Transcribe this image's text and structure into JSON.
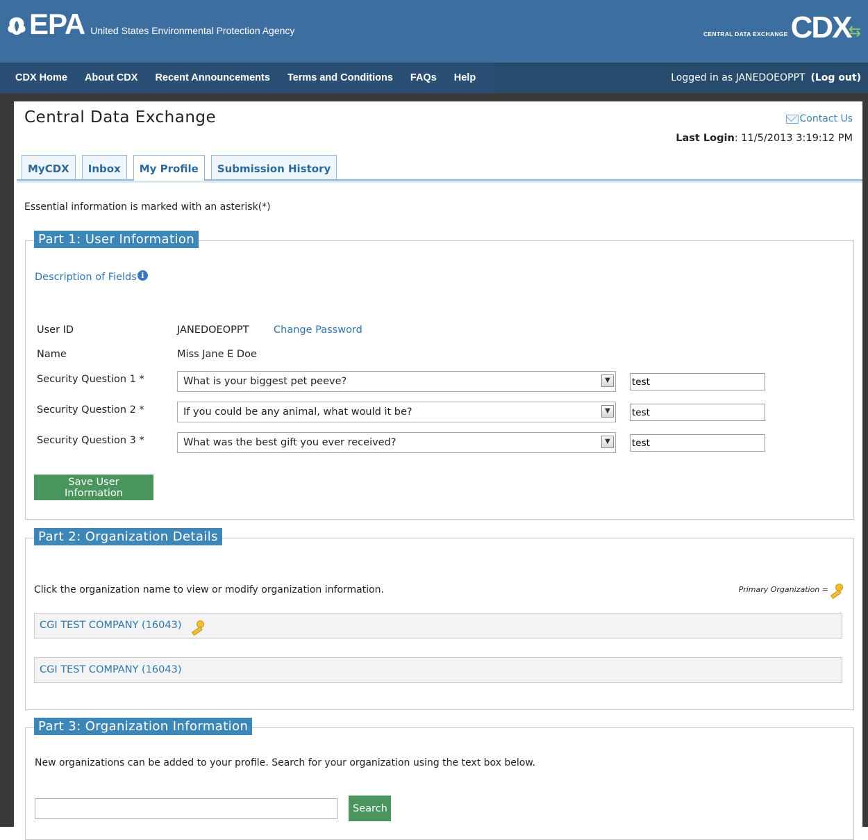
{
  "header": {
    "agency_mark": "EPA",
    "agency_name": "United States Environmental Protection Agency",
    "cdx_small": "CENTRAL DATA EXCHANGE",
    "cdx_big": "CDX"
  },
  "nav": {
    "items": [
      "CDX Home",
      "About CDX",
      "Recent Announcements",
      "Terms and Conditions",
      "FAQs",
      "Help"
    ],
    "logged_in_text": "Logged in as JANEDOEOPPT",
    "logout_label": "(Log out)"
  },
  "page": {
    "title": "Central Data Exchange",
    "contact_label": "Contact Us",
    "last_login_label": "Last Login",
    "last_login_value": ": 11/5/2013 3:19:12 PM",
    "essential_note": "Essential information is marked with an asterisk(*)"
  },
  "tabs": [
    "MyCDX",
    "Inbox",
    "My Profile",
    "Submission History"
  ],
  "part1": {
    "legend": "Part 1: User Information",
    "description_link": "Description of Fields",
    "user_id_label": "User ID",
    "user_id_value": "JANEDOEOPPT",
    "change_password": "Change Password",
    "name_label": "Name",
    "name_value": "Miss Jane E Doe",
    "questions": [
      {
        "label": "Security Question 1 *",
        "question": "What is your biggest pet peeve?",
        "answer": "test"
      },
      {
        "label": "Security Question 2 *",
        "question": "If you could be any animal, what would it be?",
        "answer": "test"
      },
      {
        "label": "Security Question 3 *",
        "question": "What was the best gift you ever received?",
        "answer": "test"
      }
    ],
    "save_button": "Save User Information"
  },
  "part2": {
    "legend": "Part 2: Organization Details",
    "hint": "Click the organization name to view or modify organization information.",
    "primary_legend": "Primary Organization =",
    "organizations": [
      "CGI TEST COMPANY (16043)",
      "CGI TEST COMPANY (16043)"
    ]
  },
  "part3": {
    "legend": "Part 3: Organization Information",
    "hint": "New organizations can be added to your profile. Search for your organization using the text box below.",
    "search_value": "",
    "search_button": "Search"
  },
  "icons": {
    "mail": "mail-icon",
    "info": "info-icon",
    "key": "key-icon",
    "select_arrow": "chevron-down-icon"
  },
  "colors": {
    "header_blue": "#3d6ea0",
    "nav_dark": "#2b4f74",
    "legend_blue": "#3d86b8",
    "button_green": "#4a945e",
    "link_blue": "#2d77ad"
  }
}
